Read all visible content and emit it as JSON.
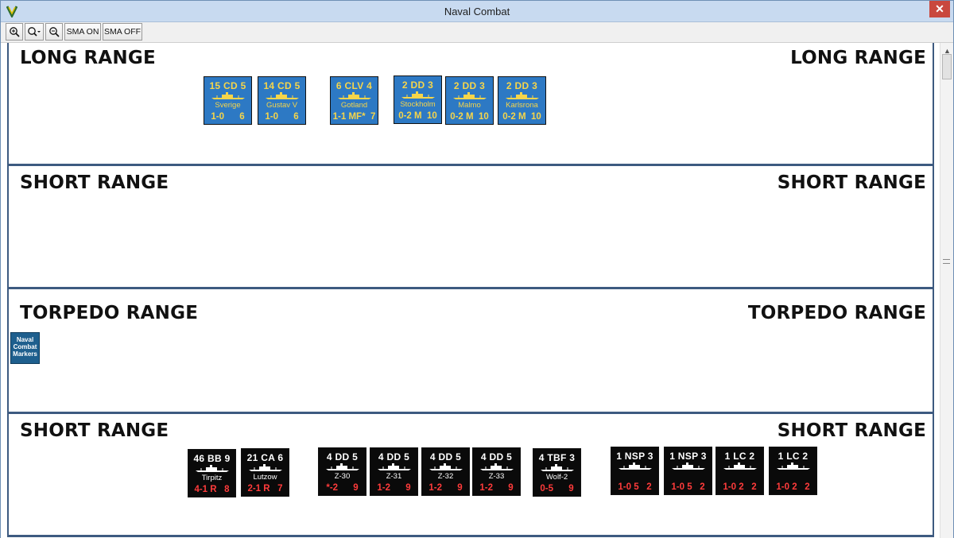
{
  "window": {
    "title": "Naval Combat",
    "close_label": "✕"
  },
  "toolbar": {
    "zoom_in": "zoom-in",
    "zoom_menu": "zoom-menu",
    "zoom_out": "zoom-out",
    "sma_on": "SMA ON",
    "sma_off": "SMA OFF"
  },
  "bands": [
    {
      "left": "LONG RANGE",
      "right": "LONG RANGE"
    },
    {
      "left": "SHORT RANGE",
      "right": "SHORT RANGE"
    },
    {
      "left": "TORPEDO RANGE",
      "right": "TORPEDO RANGE"
    },
    {
      "left": "SHORT RANGE",
      "right": "SHORT RANGE"
    }
  ],
  "marker": {
    "label": "Naval Combat Markers"
  },
  "swedish_counters": [
    {
      "top": "15 CD 5",
      "name": "Sverige",
      "bottom": "1-0      6"
    },
    {
      "top": "14 CD 5",
      "name": "Gustav V",
      "bottom": "1-0      6"
    },
    {
      "top": "6 CLV 4",
      "name": "Gotland",
      "bottom": "1-1 MF*  7"
    },
    {
      "top": "2 DD 3",
      "name": "Stockholm",
      "bottom": "0-2 M  10"
    },
    {
      "top": "2 DD 3",
      "name": "Malmo",
      "bottom": "0-2 M  10"
    },
    {
      "top": "2 DD 3",
      "name": "Karlsrona",
      "bottom": "0-2 M  10"
    }
  ],
  "german_counters": [
    {
      "top": "46 BB 9",
      "name": "Tirpitz",
      "bottom": "4-1 R   8"
    },
    {
      "top": "21 CA 6",
      "name": "Lutzow",
      "bottom": "2-1 R   7"
    },
    {
      "top": "4 DD 5",
      "name": "Z-30",
      "bottom": "*-2      9"
    },
    {
      "top": "4 DD 5",
      "name": "Z-31",
      "bottom": "1-2      9"
    },
    {
      "top": "4 DD 5",
      "name": "Z-32",
      "bottom": "1-2      9"
    },
    {
      "top": "4 DD 5",
      "name": "Z-33",
      "bottom": "1-2      9"
    },
    {
      "top": "4 TBF 3",
      "name": "Wolf-2",
      "bottom": "0-5      9"
    },
    {
      "top": "1 NSP 3",
      "name": "",
      "bottom": "1-0 5   2"
    },
    {
      "top": "1 NSP 3",
      "name": "",
      "bottom": "1-0 5   2"
    },
    {
      "top": "1 LC 2",
      "name": "",
      "bottom": "1-0 2   2"
    },
    {
      "top": "1 LC 2",
      "name": "",
      "bottom": "1-0 2   2"
    }
  ],
  "colors": {
    "band_border": "#3d5a80",
    "swedish_counter": "#2d79c4",
    "swedish_text": "#f6d54a",
    "german_counter": "#0a0a0a",
    "german_stat": "#ff3b3b"
  }
}
